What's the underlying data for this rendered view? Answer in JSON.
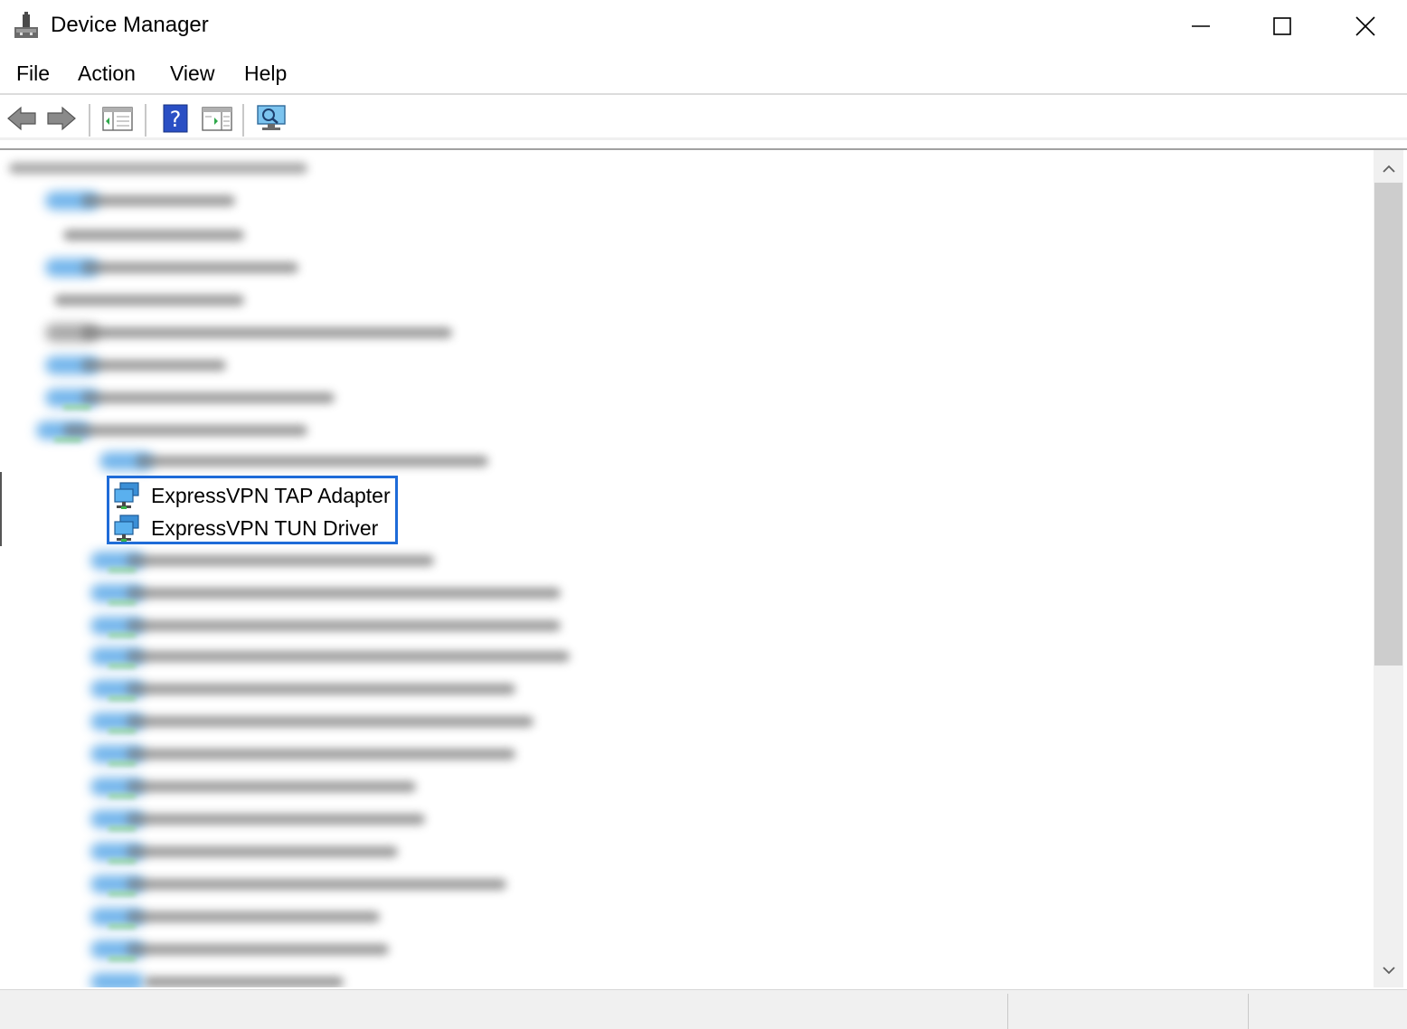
{
  "window": {
    "title": "Device Manager",
    "controls": {
      "minimize": "minimize-icon",
      "maximize": "maximize-icon",
      "close": "close-icon"
    }
  },
  "menu": {
    "items": [
      {
        "label": "File"
      },
      {
        "label": "Action"
      },
      {
        "label": "View"
      },
      {
        "label": "Help"
      }
    ]
  },
  "toolbar": {
    "buttons": [
      {
        "icon": "back-arrow-icon"
      },
      {
        "icon": "forward-arrow-icon"
      },
      {
        "icon": "show-hide-console-tree-icon"
      },
      {
        "icon": "help-icon"
      },
      {
        "icon": "show-hide-action-pane-icon"
      },
      {
        "icon": "scan-hardware-changes-icon"
      }
    ]
  },
  "tree": {
    "visible_devices": [
      {
        "label": "ExpressVPN TAP Adapter",
        "icon": "network-adapter-icon",
        "highlighted": true
      },
      {
        "label": "ExpressVPN TUN Driver",
        "icon": "network-adapter-icon",
        "highlighted": true
      }
    ],
    "blurred_rows_note": ""
  },
  "colors": {
    "highlight_border": "#1e6bd8",
    "status_bar": "#f0f0f0",
    "scrollbar_thumb": "#cdcdcd"
  }
}
